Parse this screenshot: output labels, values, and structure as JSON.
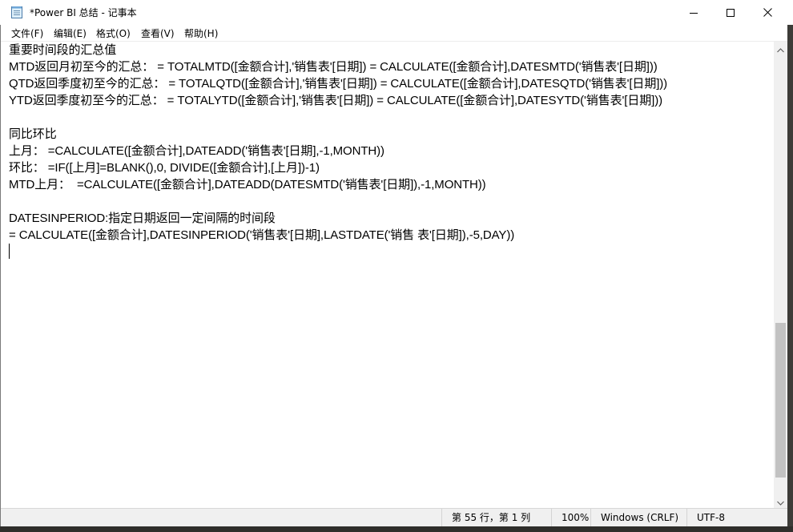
{
  "window": {
    "title": "*Power BI 总结 - 记事本"
  },
  "menu": {
    "items": [
      "文件(F)",
      "编辑(E)",
      "格式(O)",
      "查看(V)",
      "帮助(H)"
    ]
  },
  "editor": {
    "lines": [
      "重要时间段的汇总值",
      "MTD返回月初至今的汇总： = TOTALMTD([金额合计],'销售表'[日期]) = CALCULATE([金额合计],DATESMTD('销售表'[日期]))",
      "QTD返回季度初至今的汇总： = TOTALQTD([金额合计],'销售表'[日期]) = CALCULATE([金额合计],DATESQTD('销售表'[日期]))",
      "YTD返回季度初至今的汇总： = TOTALYTD([金额合计],'销售表'[日期]) = CALCULATE([金额合计],DATESYTD('销售表'[日期]))",
      "",
      "同比环比",
      "上月： =CALCULATE([金额合计],DATEADD('销售表'[日期],-1,MONTH))",
      "环比： =IF([上月]=BLANK(),0, DIVIDE([金额合计],[上月])-1)",
      "MTD上月：  =CALCULATE([金额合计],DATEADD(DATESMTD('销售表'[日期]),-1,MONTH))",
      "",
      "DATESINPERIOD:指定日期返回一定间隔的时间段",
      "= CALCULATE([金额合计],DATESINPERIOD('销售表'[日期],LASTDATE('销售 表'[日期]),-5,DAY))"
    ]
  },
  "statusbar": {
    "position": "第 55 行，第 1 列",
    "zoom": "100%",
    "line_ending": "Windows (CRLF)",
    "encoding": "UTF-8"
  },
  "icons": {
    "app": "notepad-icon",
    "minimize": "minimize-icon",
    "maximize": "maximize-icon",
    "close": "close-icon",
    "scroll_up": "chevron-up-icon",
    "scroll_down": "chevron-down-icon"
  }
}
